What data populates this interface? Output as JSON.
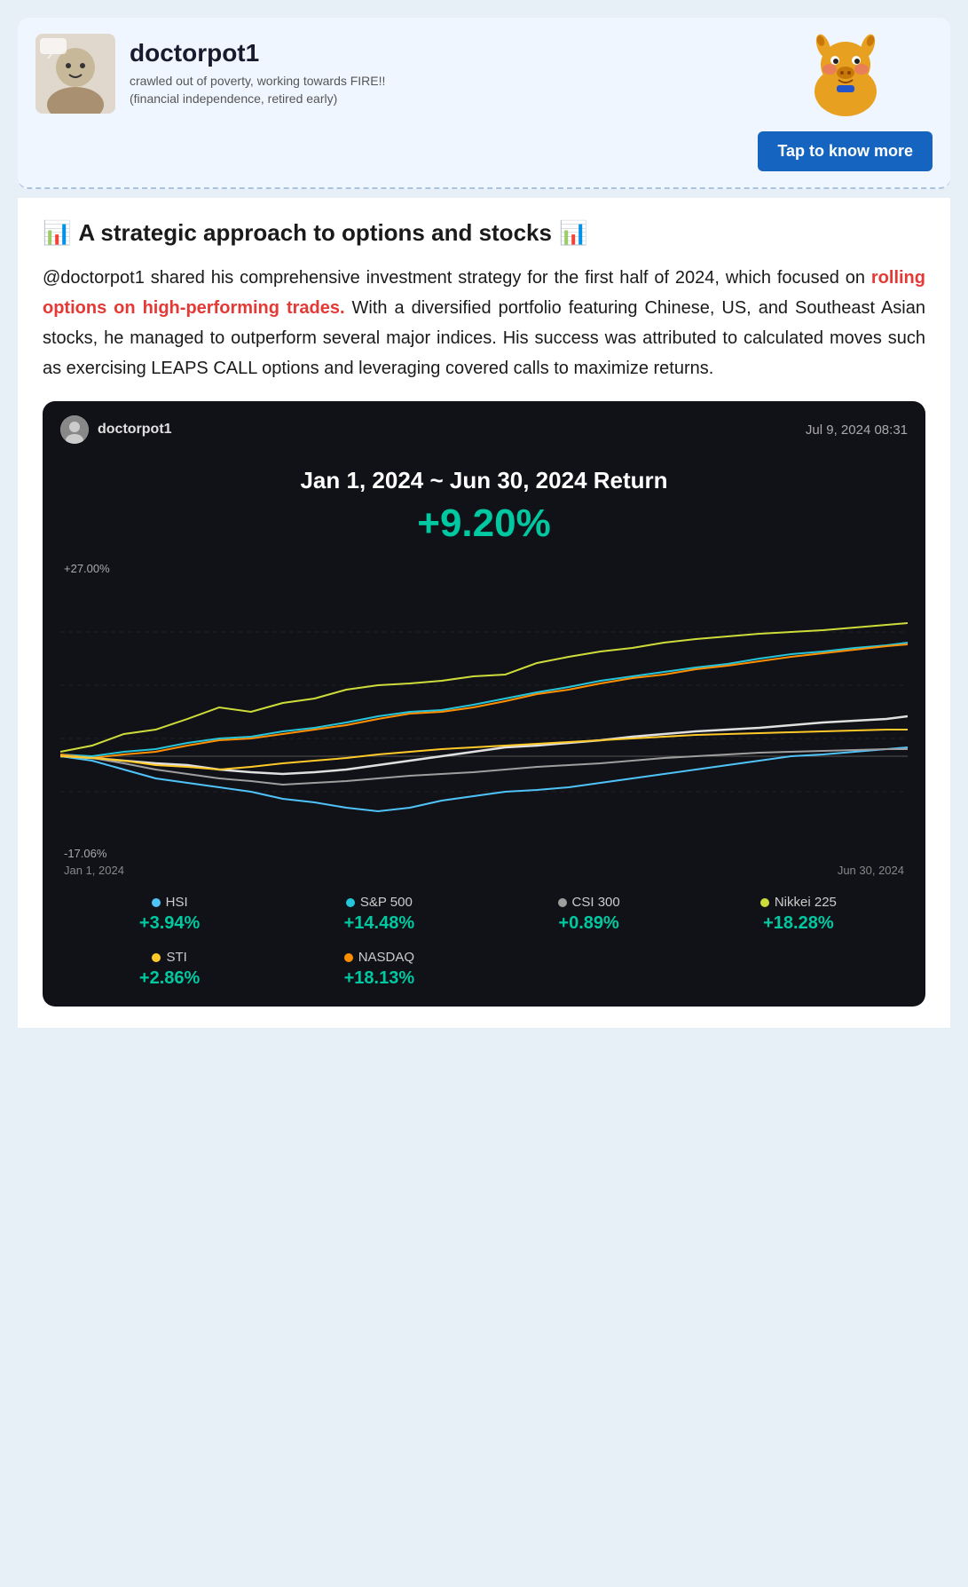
{
  "profile": {
    "username": "doctorpot1",
    "bio_line1": "crawled out of poverty, working towards FIRE!!",
    "bio_line2": "(financial independence, retired early)",
    "tap_button_label": "Tap to know more"
  },
  "article": {
    "title_icon_left": "📊",
    "title_text": "A strategic approach to options and stocks",
    "title_icon_right": "📊",
    "body_part1": "@doctorpot1 shared his comprehensive investment strategy for the first half of 2024, which focused on ",
    "highlight": "rolling options on high-performing trades.",
    "body_part2": " With a diversified portfolio featuring Chinese, US, and Southeast Asian stocks, he managed to outperform several major indices. His success was attributed to calculated moves such as exercising LEAPS CALL options and leveraging covered calls to maximize returns."
  },
  "chart": {
    "username": "doctorpot1",
    "timestamp": "Jul 9, 2024 08:31",
    "period_title": "Jan 1, 2024 ~ Jun 30, 2024 Return",
    "return_value": "+9.20%",
    "y_axis_top": "+27.00%",
    "y_axis_bottom": "-17.06%",
    "x_axis_start": "Jan 1, 2024",
    "x_axis_end": "Jun 30, 2024",
    "legend": [
      {
        "label": "HSI",
        "color": "#4fc3f7",
        "value": "+3.94%"
      },
      {
        "label": "S&P 500",
        "color": "#26c6da",
        "value": "+14.48%"
      },
      {
        "label": "CSI 300",
        "color": "#9e9e9e",
        "value": "+0.89%"
      },
      {
        "label": "Nikkei 225",
        "color": "#cddc39",
        "value": "+18.28%"
      },
      {
        "label": "STI",
        "color": "#ffca28",
        "value": "+2.86%"
      },
      {
        "label": "NASDAQ",
        "color": "#ff8f00",
        "value": "+18.13%"
      }
    ]
  }
}
